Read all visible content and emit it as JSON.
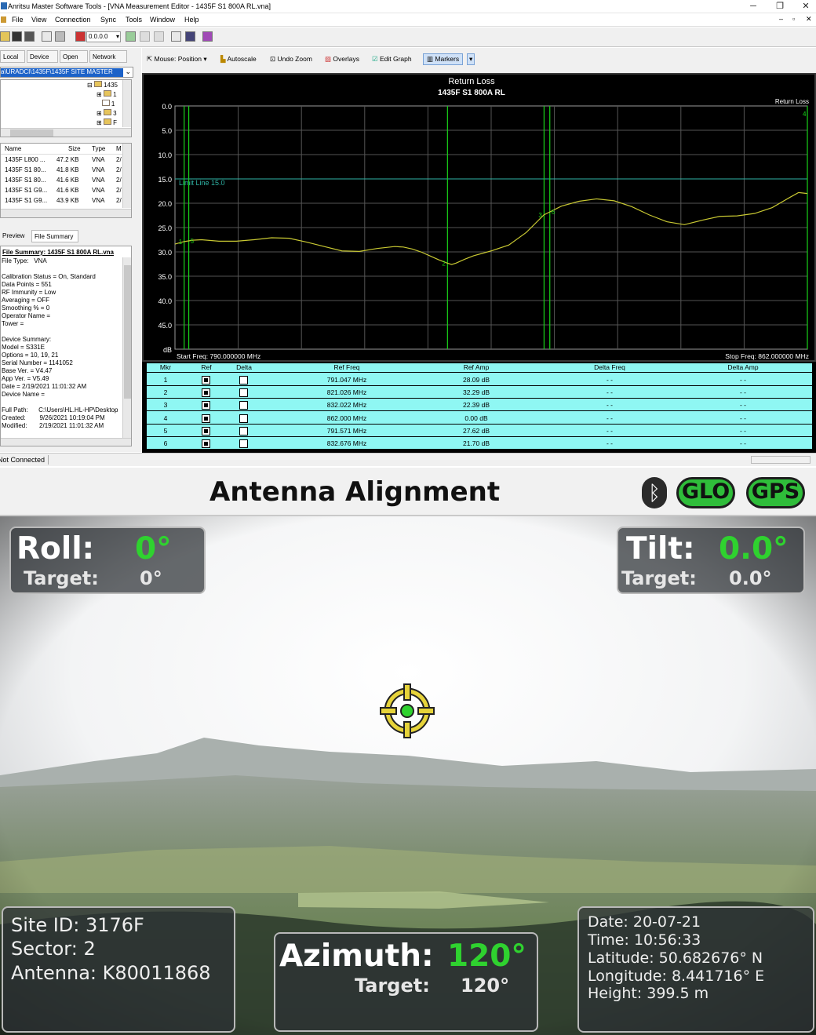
{
  "window": {
    "title": "Anritsu Master Software Tools - [VNA Measurement Editor -  1435F S1 800A RL.vna]",
    "controls": {
      "minimize": "─",
      "restore": "❐",
      "close": "✕"
    },
    "inner_controls": {
      "minimize": "–",
      "restore": "▫",
      "close": "✕"
    }
  },
  "menu": [
    "File",
    "View",
    "Connection",
    "Sync",
    "Tools",
    "Window",
    "Help"
  ],
  "toolbar": {
    "freq_value": "0.0.0.0"
  },
  "left_panel": {
    "tabs": [
      "Local",
      "Device",
      "Open",
      "Network"
    ],
    "path": "a\\URADCI\\1435F\\1435F SITE MASTER",
    "tree": [
      "1435",
      "1",
      "1",
      "3",
      "F"
    ],
    "file_columns": [
      "Name",
      "Size",
      "Type",
      "M"
    ],
    "files": [
      {
        "name": "1435F L800 ...",
        "size": "47.2 KB",
        "type": "VNA",
        "m": "2/"
      },
      {
        "name": "1435F S1 80...",
        "size": "41.8 KB",
        "type": "VNA",
        "m": "2/"
      },
      {
        "name": "1435F S1 80...",
        "size": "41.6 KB",
        "type": "VNA",
        "m": "2/"
      },
      {
        "name": "1435F S1 G9...",
        "size": "41.6 KB",
        "type": "VNA",
        "m": "2/"
      },
      {
        "name": "1435F S1 G9...",
        "size": "43.9 KB",
        "type": "VNA",
        "m": "2/"
      }
    ],
    "preview_tabs": [
      "Preview",
      "File Summary"
    ],
    "summary_title": "File Summary: 1435F S1 800A RL.vna",
    "summary_lines": [
      "File Type:   VNA",
      "",
      "Calibration Status = On, Standard",
      "Data Points = 551",
      "RF Immunity = Low",
      "Averaging = OFF",
      "Smoothing % = 0",
      "Operator Name =",
      "Tower =",
      "",
      "Device Summary:",
      "Model = S331E",
      "Options = 10, 19, 21",
      "Serial Number = 1141052",
      "Base Ver. = V4.47",
      "App Ver. = V5.49",
      "Date = 2/19/2021 11:01:32 AM",
      "Device Name =",
      "",
      "Full Path:      C:\\Users\\HL.HL-HP\\Desktop",
      "Created:        9/26/2021 10:19:04 PM",
      "Modified:       2/19/2021 11:01:32 AM"
    ]
  },
  "graph_toolbar": [
    "Mouse: Position",
    "Autoscale",
    "Undo Zoom",
    "Overlays",
    "Edit Graph",
    "Markers"
  ],
  "chart_data": {
    "type": "line",
    "title": "Return Loss",
    "subtitle": "1435F S1 800A RL",
    "legend": "Return Loss",
    "ylabel": "dB",
    "ylim": [
      0,
      50
    ],
    "yticks": [
      "0.0",
      "5.0",
      "10.0",
      "15.0",
      "20.0",
      "25.0",
      "30.0",
      "35.0",
      "40.0",
      "45.0"
    ],
    "y_inverted": true,
    "grid": true,
    "xlim": [
      790,
      862
    ],
    "start_label": "Start Freq: 790.000000 MHz",
    "stop_label": "Stop Freq: 862.000000 MHz",
    "limit_line": {
      "value": 15.0,
      "label": "Limit Line 15.0",
      "color": "#2fb5a6"
    },
    "trace_color": "#c8c832",
    "series": [
      {
        "x": [
          790,
          791,
          792,
          793,
          795,
          797,
          799,
          801,
          803,
          805,
          807,
          809,
          811,
          813,
          815,
          816,
          817,
          818,
          819,
          820,
          821,
          821.5,
          822,
          823,
          824,
          826,
          828,
          830,
          832,
          834,
          836,
          838,
          840,
          842,
          844,
          846,
          848,
          850,
          852,
          854,
          856,
          858,
          860,
          861,
          862
        ],
        "y": [
          28.4,
          27.9,
          27.6,
          27.5,
          27.8,
          27.8,
          27.5,
          27.1,
          27.2,
          28.0,
          28.9,
          29.8,
          29.9,
          29.3,
          28.9,
          29.0,
          29.4,
          30.0,
          30.8,
          31.6,
          32.3,
          32.6,
          32.3,
          31.5,
          30.8,
          29.8,
          28.6,
          26.0,
          22.4,
          20.6,
          19.6,
          19.1,
          19.5,
          20.7,
          22.4,
          23.8,
          24.4,
          23.5,
          22.7,
          22.6,
          22.1,
          20.9,
          18.8,
          17.8,
          18.0
        ]
      }
    ],
    "markers": [
      {
        "id": "1",
        "x": 791.047
      },
      {
        "id": "2",
        "x": 821.026
      },
      {
        "id": "3",
        "x": 832.022
      },
      {
        "id": "4",
        "x": 862.0
      },
      {
        "id": "5",
        "x": 791.571
      },
      {
        "id": "6",
        "x": 832.676
      }
    ]
  },
  "marker_table": {
    "columns": [
      "Mkr",
      "Ref",
      "Delta",
      "Ref Freq",
      "Ref Amp",
      "Delta Freq",
      "Delta Amp"
    ],
    "rows": [
      {
        "mkr": "1",
        "freq": "791.047 MHz",
        "amp": "28.09 dB",
        "dfreq": "- -",
        "damp": "- -"
      },
      {
        "mkr": "2",
        "freq": "821.026 MHz",
        "amp": "32.29 dB",
        "dfreq": "- -",
        "damp": "- -"
      },
      {
        "mkr": "3",
        "freq": "832.022 MHz",
        "amp": "22.39 dB",
        "dfreq": "- -",
        "damp": "- -"
      },
      {
        "mkr": "4",
        "freq": "862.000 MHz",
        "amp": "0.00 dB",
        "dfreq": "- -",
        "damp": "- -"
      },
      {
        "mkr": "5",
        "freq": "791.571 MHz",
        "amp": "27.62 dB",
        "dfreq": "- -",
        "damp": "- -"
      },
      {
        "mkr": "6",
        "freq": "832.676 MHz",
        "amp": "21.70 dB",
        "dfreq": "- -",
        "damp": "- -"
      }
    ]
  },
  "status": {
    "connection": "Not Connected"
  },
  "antenna": {
    "title": "Antenna Alignment",
    "badges": [
      "GLO",
      "GPS"
    ],
    "roll": {
      "label": "Roll:",
      "value": "0°",
      "target_label": "Target:",
      "target": "0°"
    },
    "tilt": {
      "label": "Tilt:",
      "value": "0.0°",
      "target_label": "Target:",
      "target": "0.0°"
    },
    "azimuth": {
      "label": "Azimuth:",
      "value": "120°",
      "target_label": "Target:",
      "target": "120°"
    },
    "site": {
      "site_id": "Site ID: 3176F",
      "sector": "Sector: 2",
      "antenna": "Antenna: K80011868"
    },
    "gps": {
      "date": "Date: 20-07-21",
      "time": "Time: 10:56:33",
      "latitude": "Latitude: 50.682676° N",
      "longitude": "Longitude: 8.441716° E",
      "height": "Height: 399.5 m"
    },
    "colors": {
      "accent_green": "#2fd22f",
      "badge_green": "#2fbd3a"
    }
  }
}
